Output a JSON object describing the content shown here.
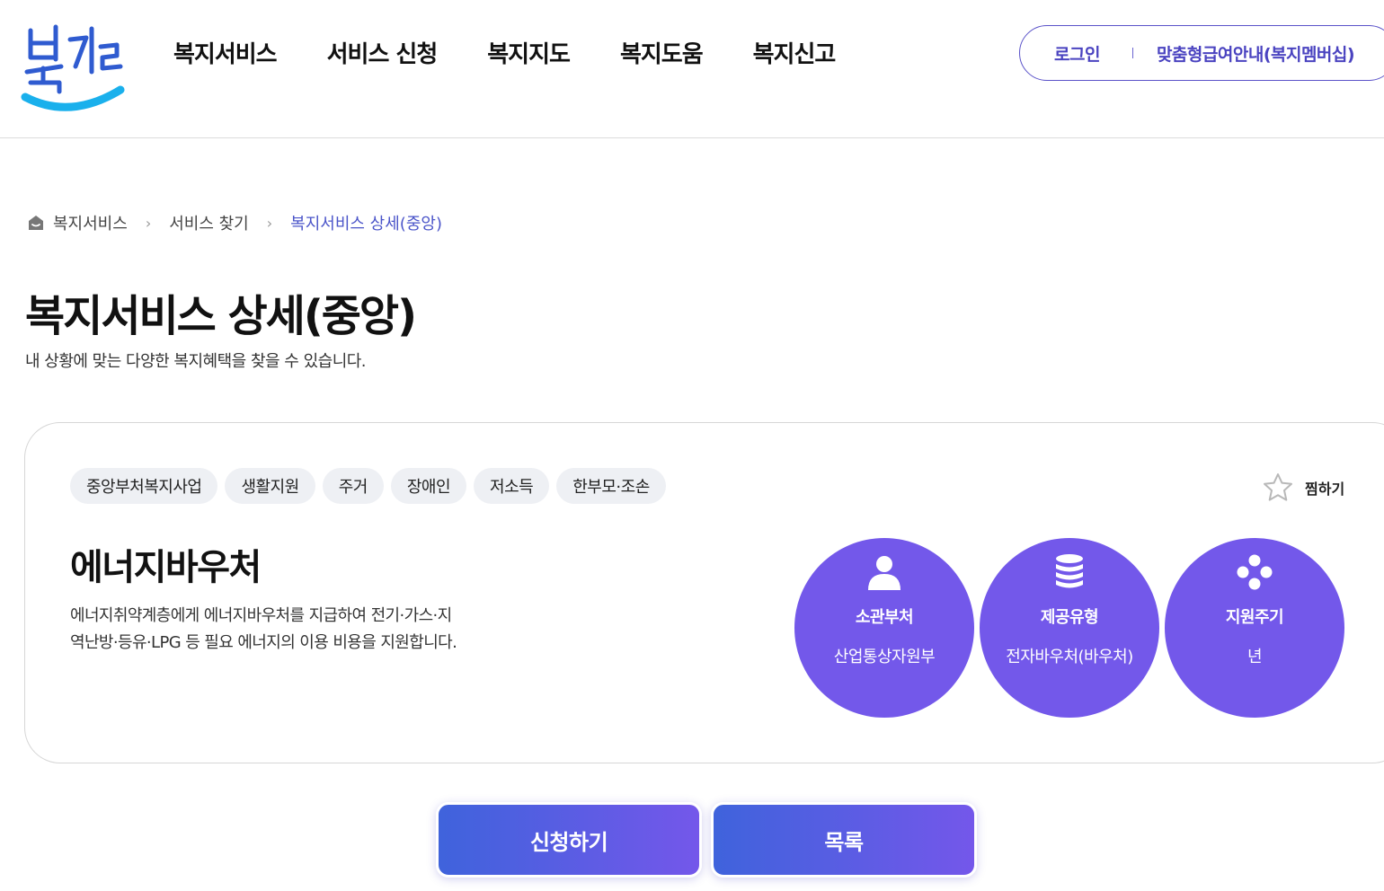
{
  "header": {
    "logo_text": "복지로",
    "nav": [
      "복지서비스",
      "서비스 신청",
      "복지지도",
      "복지도움",
      "복지신고"
    ],
    "login_label": "로그인",
    "membership_label": "맞춤형급여안내(복지멤버십)"
  },
  "breadcrumb": {
    "items": [
      "복지서비스",
      "서비스 찾기",
      "복지서비스 상세(중앙)"
    ]
  },
  "page": {
    "title": "복지서비스 상세(중앙)",
    "description": "내 상황에 맞는 다양한 복지혜택을 찾을 수 있습니다."
  },
  "service": {
    "tags": [
      "중앙부처복지사업",
      "생활지원",
      "주거",
      "장애인",
      "저소득",
      "한부모·조손"
    ],
    "favorite_label": "찜하기",
    "title": "에너지바우처",
    "description_line1": "에너지취약계층에게 에너지바우처를 지급하여 전기·가스·지",
    "description_line2": "역난방·등유·LPG 등 필요 에너지의 이용 비용을 지원합니다.",
    "info": [
      {
        "label": "소관부처",
        "value": "산업통상자원부",
        "icon": "person-icon"
      },
      {
        "label": "제공유형",
        "value": "전자바우처(바우처)",
        "icon": "coins-icon"
      },
      {
        "label": "지원주기",
        "value": "년",
        "icon": "dots-icon"
      }
    ]
  },
  "actions": {
    "apply_label": "신청하기",
    "list_label": "목록"
  },
  "colors": {
    "brand_purple": "#7358ea",
    "brand_blue": "#3f63dc",
    "logo_cyan": "#1ab0ec",
    "logo_blue": "#2f5bd0"
  }
}
